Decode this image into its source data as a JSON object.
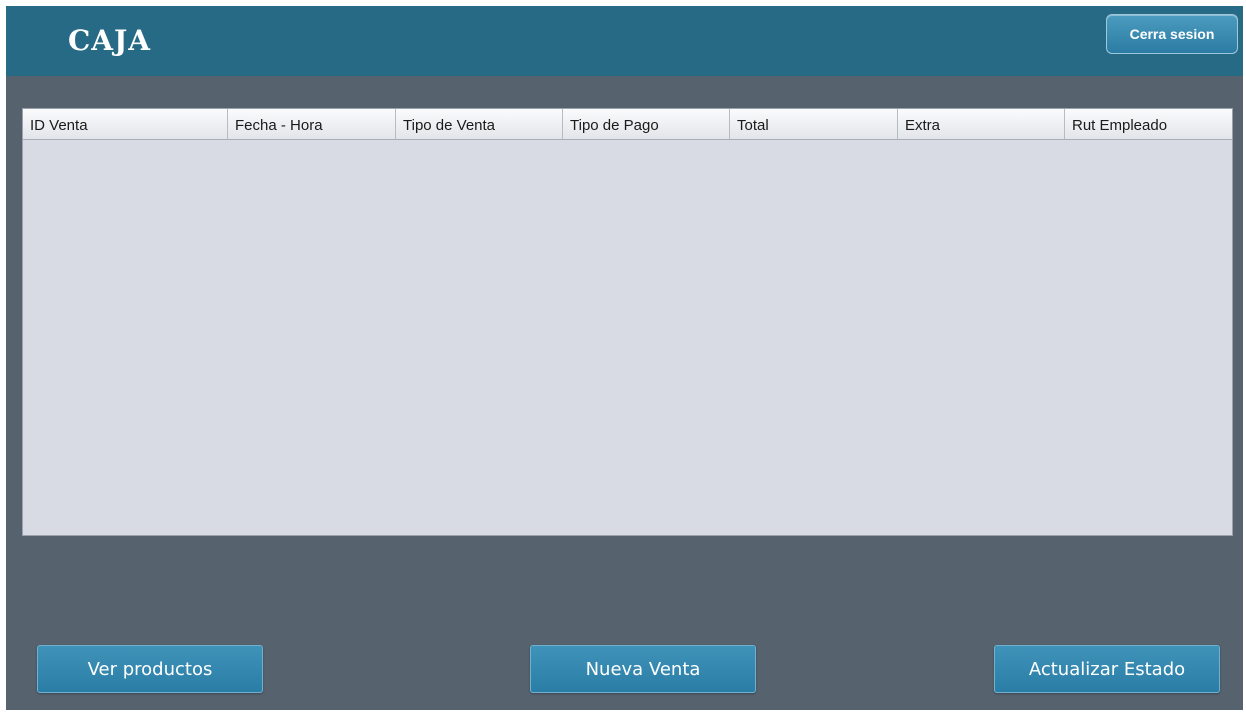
{
  "header": {
    "title": "CAJA",
    "logout_label": "Cerra sesion"
  },
  "table": {
    "columns": [
      "ID Venta",
      "Fecha - Hora",
      "Tipo de Venta",
      "Tipo de Pago",
      "Total",
      "Extra",
      "Rut Empleado"
    ],
    "rows": []
  },
  "footer": {
    "view_products_label": "Ver productos",
    "new_sale_label": "Nueva Venta",
    "update_status_label": "Actualizar Estado"
  },
  "colors": {
    "header_bg": "#276a85",
    "background": "#56636f",
    "table_bg": "#d8dbe3",
    "button_bg": "#2f86ad"
  }
}
